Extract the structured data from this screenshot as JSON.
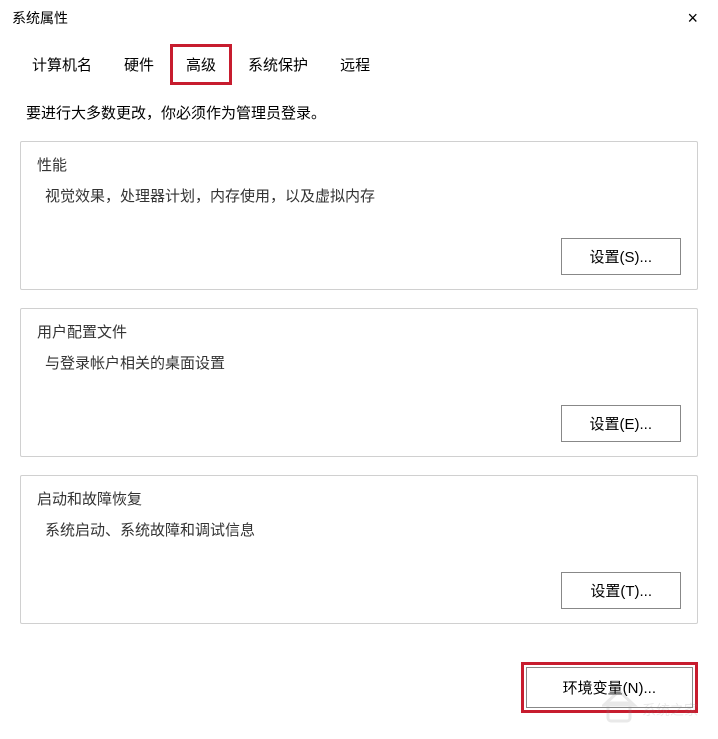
{
  "titlebar": {
    "title": "系统属性",
    "close_label": "×"
  },
  "tabs": {
    "computer_name": "计算机名",
    "hardware": "硬件",
    "advanced": "高级",
    "system_protection": "系统保护",
    "remote": "远程"
  },
  "instruction": "要进行大多数更改，你必须作为管理员登录。",
  "sections": {
    "performance": {
      "title": "性能",
      "desc": "视觉效果，处理器计划，内存使用，以及虚拟内存",
      "button": "设置(S)..."
    },
    "user_profiles": {
      "title": "用户配置文件",
      "desc": "与登录帐户相关的桌面设置",
      "button": "设置(E)..."
    },
    "startup_recovery": {
      "title": "启动和故障恢复",
      "desc": "系统启动、系统故障和调试信息",
      "button": "设置(T)..."
    }
  },
  "env_button": "环境变量(N)..."
}
